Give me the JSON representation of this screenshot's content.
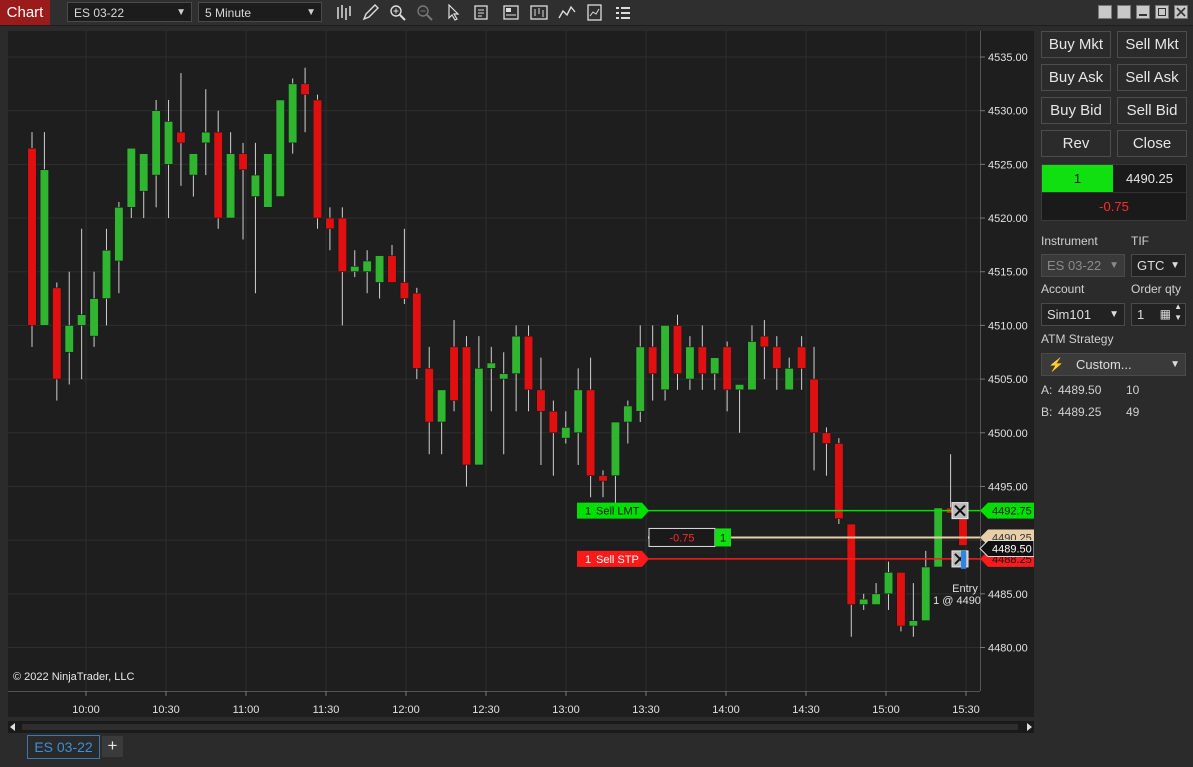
{
  "window": {
    "badge": "Chart",
    "instrument_select": "ES 03-22",
    "interval_select": "5 Minute",
    "toolbar_icons": [
      "bar-type-icon",
      "draw-pencil-icon",
      "zoom-in-icon",
      "zoom-out-icon",
      "pointer-icon",
      "properties-icon",
      "data-box-icon",
      "chart-trader-icon",
      "indicators-icon",
      "strategies-icon",
      "templates-icon"
    ]
  },
  "chart_data": {
    "type": "candlestick",
    "instrument": "ES 03-22",
    "interval": "5 Minute",
    "ylim": [
      4477,
      4538
    ],
    "y_ticks": [
      "4535.00",
      "4530.00",
      "4525.00",
      "4520.00",
      "4515.00",
      "4510.00",
      "4505.00",
      "4500.00",
      "4495.00",
      "4490.00",
      "4485.00",
      "4480.00"
    ],
    "x_ticks": [
      "10:00",
      "10:30",
      "11:00",
      "11:30",
      "12:00",
      "12:30",
      "13:00",
      "13:30",
      "14:00",
      "14:30",
      "15:00",
      "15:30"
    ],
    "colors": {
      "up": "#2fb52f",
      "down": "#e01010",
      "background": "#1e1e1e",
      "grid": "#2e2e2e"
    },
    "candles": [
      [
        4526.5,
        4528,
        4508,
        4510
      ],
      [
        4510,
        4528,
        4510,
        4524.5
      ],
      [
        4513.5,
        4514,
        4503,
        4505
      ],
      [
        4507.5,
        4515,
        4504.5,
        4510
      ],
      [
        4510,
        4519,
        4505,
        4511
      ],
      [
        4509,
        4515,
        4508,
        4512.5
      ],
      [
        4512.5,
        4519,
        4510,
        4517
      ],
      [
        4516,
        4521.5,
        4513,
        4521
      ],
      [
        4521,
        4525,
        4520,
        4526.5
      ],
      [
        4522.5,
        4524,
        4520,
        4526
      ],
      [
        4524,
        4531,
        4521,
        4530
      ],
      [
        4525,
        4531,
        4520,
        4529
      ],
      [
        4528,
        4533.5,
        4523,
        4527
      ],
      [
        4524,
        4525,
        4522,
        4526
      ],
      [
        4527,
        4532,
        4524,
        4528
      ],
      [
        4528,
        4530,
        4519,
        4520
      ],
      [
        4520,
        4528,
        4520,
        4526
      ],
      [
        4526,
        4527,
        4518,
        4524.5
      ],
      [
        4522,
        4527,
        4513,
        4524
      ],
      [
        4521,
        4523,
        4521,
        4526
      ],
      [
        4522,
        4530,
        4523,
        4531
      ],
      [
        4527,
        4533,
        4526,
        4532.5
      ],
      [
        4532.5,
        4534,
        4528,
        4531.5
      ],
      [
        4531,
        4531.5,
        4519,
        4520
      ],
      [
        4520,
        4521,
        4517,
        4519
      ],
      [
        4520,
        4521,
        4510,
        4515
      ],
      [
        4515,
        4517,
        4514.5,
        4515.5
      ],
      [
        4515,
        4517,
        4513,
        4516
      ],
      [
        4514,
        4516,
        4512.5,
        4516.5
      ],
      [
        4516.5,
        4517.5,
        4514,
        4514
      ],
      [
        4514,
        4519,
        4512,
        4512.5
      ],
      [
        4513,
        4513.5,
        4505,
        4506
      ],
      [
        4506,
        4508,
        4498,
        4501
      ],
      [
        4501,
        4504,
        4498,
        4504
      ],
      [
        4508,
        4510.5,
        4502,
        4503
      ],
      [
        4508,
        4509,
        4495,
        4497
      ],
      [
        4497,
        4509,
        4497,
        4506
      ],
      [
        4506,
        4508,
        4502,
        4506.5
      ],
      [
        4505,
        4507.5,
        4498,
        4505.5
      ],
      [
        4505.5,
        4510,
        4502,
        4509
      ],
      [
        4509,
        4510,
        4502,
        4504
      ],
      [
        4504,
        4507,
        4497,
        4502
      ],
      [
        4502,
        4503,
        4496,
        4500
      ],
      [
        4499.5,
        4502,
        4499,
        4500.5
      ],
      [
        4500,
        4506,
        4497,
        4504
      ],
      [
        4504,
        4507,
        4494,
        4496
      ],
      [
        4496,
        4496.5,
        4494,
        4495.5
      ],
      [
        4496,
        4501,
        4493,
        4501
      ],
      [
        4501,
        4503,
        4499,
        4502.5
      ],
      [
        4502,
        4510,
        4501,
        4508
      ],
      [
        4508,
        4510,
        4503,
        4505.5
      ],
      [
        4504,
        4509,
        4503,
        4510
      ],
      [
        4510,
        4511,
        4504,
        4505.5
      ],
      [
        4505,
        4509,
        4504,
        4508
      ],
      [
        4508,
        4510,
        4504,
        4505.5
      ],
      [
        4505.5,
        4507,
        4504,
        4507
      ],
      [
        4508,
        4508.5,
        4502,
        4504
      ],
      [
        4504,
        4504.5,
        4500,
        4504.5
      ],
      [
        4504,
        4510,
        4504,
        4508.5
      ],
      [
        4509,
        4510.5,
        4505,
        4508
      ],
      [
        4508,
        4509,
        4504,
        4506
      ],
      [
        4504,
        4507,
        4505,
        4506
      ],
      [
        4508,
        4509,
        4504,
        4506
      ],
      [
        4505,
        4508,
        4496.5,
        4500
      ],
      [
        4500,
        4500.5,
        4496,
        4499
      ],
      [
        4499,
        4499.5,
        4491.5,
        4492
      ],
      [
        4491.5,
        4491.5,
        4481,
        4484
      ],
      [
        4484,
        4485,
        4483.5,
        4484.5
      ],
      [
        4484,
        4486,
        4484,
        4485
      ],
      [
        4485,
        4488,
        4483.5,
        4487
      ],
      [
        4487,
        4487,
        4481.5,
        4482
      ],
      [
        4482,
        4486,
        4481,
        4482.5
      ],
      [
        4482.5,
        4489,
        4482.5,
        4487.5
      ],
      [
        4487.5,
        4492.5,
        4487.5,
        4493
      ],
      [
        4493,
        4498,
        4492.5,
        4492.5
      ],
      [
        4492.5,
        4493,
        4489.5,
        4489.5
      ]
    ],
    "orders": [
      {
        "label": "Sell LMT",
        "qty": "1",
        "price": "4492.75",
        "color": "#00e000"
      },
      {
        "label": "Sell STP",
        "qty": "1",
        "price": "4488.25",
        "color": "#ff1a1a"
      }
    ],
    "position": {
      "pnl": "-0.75",
      "qty": "1",
      "avg_price": "4490.25",
      "color": "#e8cfa8"
    },
    "last_price": "4489.50",
    "entry_label": "Entry",
    "entry_detail": "1 @ 4490"
  },
  "copyright": "© 2022 NinjaTrader, LLC",
  "panel": {
    "buy_mkt": "Buy Mkt",
    "sell_mkt": "Sell Mkt",
    "buy_ask": "Buy Ask",
    "sell_ask": "Sell Ask",
    "buy_bid": "Buy Bid",
    "sell_bid": "Sell Bid",
    "rev": "Rev",
    "close": "Close",
    "position_qty": "1",
    "position_price": "4490.25",
    "position_pnl": "-0.75",
    "instrument_label": "Instrument",
    "tif_label": "TIF",
    "instrument_value": "ES 03-22",
    "tif_value": "GTC",
    "account_label": "Account",
    "qty_label": "Order qty",
    "account_value": "Sim101",
    "qty_value": "1",
    "atm_label": "ATM Strategy",
    "atm_value": "Custom...",
    "ask_label": "A:",
    "ask_price": "4489.50",
    "ask_size": "10",
    "bid_label": "B:",
    "bid_price": "4489.25",
    "bid_size": "49"
  },
  "tabs": {
    "active": "ES 03-22",
    "add": "+"
  }
}
